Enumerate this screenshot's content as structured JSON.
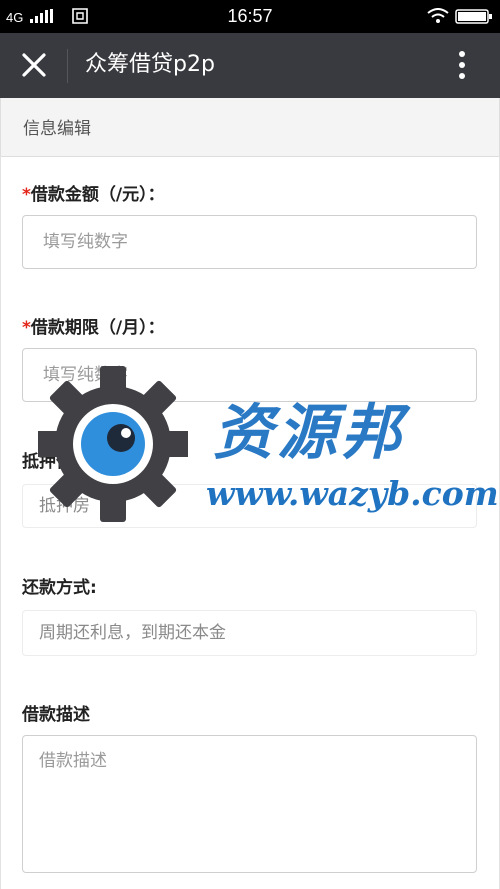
{
  "status_bar": {
    "network": "4G",
    "time": "16:57",
    "sim_icon": "sim-card-icon",
    "signal_icon": "signal-bars-icon",
    "wifi_icon": "wifi-icon",
    "battery_icon": "battery-icon"
  },
  "app_bar": {
    "title": "众筹借贷p2p",
    "close_icon": "close-icon",
    "more_icon": "more-vertical-icon"
  },
  "section": {
    "title": "信息编辑"
  },
  "form": {
    "loan_amount": {
      "required_mark": "*",
      "label": "借款金额（/元）：",
      "placeholder": "填写纯数字",
      "value": ""
    },
    "loan_term": {
      "required_mark": "*",
      "label": "借款期限（/月）：",
      "placeholder": "填写纯数字",
      "value": ""
    },
    "collateral": {
      "label": "抵押信息:",
      "selected": "抵押房"
    },
    "repayment": {
      "label": "还款方式:",
      "selected": "周期还利息，到期还本金"
    },
    "description": {
      "label": "借款描述",
      "placeholder": "借款描述",
      "value": ""
    }
  },
  "watermark": {
    "title": "资源邦",
    "url": "www.wazyb.com",
    "colors": {
      "gear": "#404045",
      "eye": "#2f8fdc",
      "text": "#2a79c4"
    }
  }
}
